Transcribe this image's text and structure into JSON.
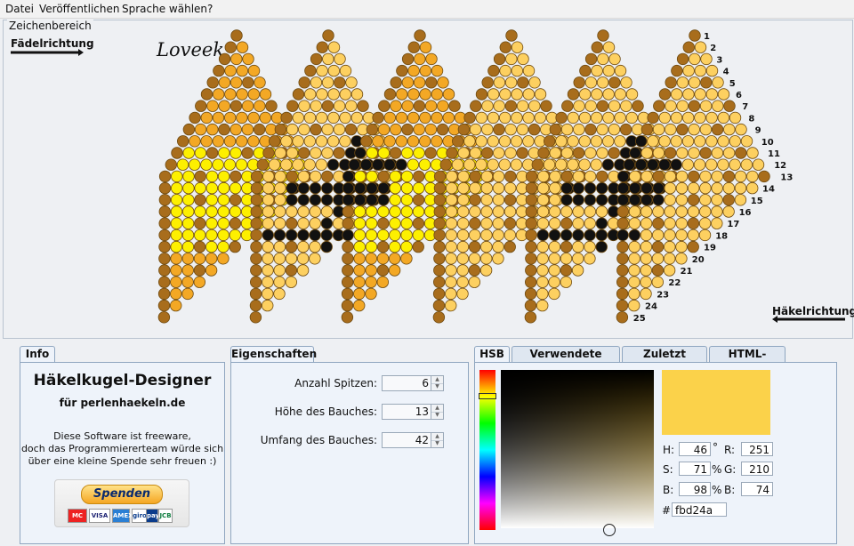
{
  "menu": [
    "Datei",
    "Veröffentlichen",
    "Sprache wählen",
    "?"
  ],
  "drawing": {
    "title": "Zeichenbereich",
    "thread_direction_label": "Fädelrichtung",
    "crochet_direction_label": "Häkelrichtung",
    "signature": "Loveek",
    "row_numbers": [
      "1",
      "2",
      "3",
      "4",
      "5",
      "6",
      "7",
      "8",
      "9",
      "10",
      "11",
      "12",
      "13",
      "14",
      "15",
      "16",
      "17",
      "18",
      "19",
      "20",
      "21",
      "22",
      "23",
      "24",
      "25"
    ],
    "palette": {
      "outline": "#6e4a10",
      "dark": "#a86d1c",
      "orange": "#f3a825",
      "light": "#fdd060",
      "yellow": "#fdf000",
      "black": "#111111"
    }
  },
  "tabs_left": {
    "info": "Info",
    "properties": "Eigenschaften"
  },
  "info": {
    "title": "Häkelkugel-Designer",
    "subtitle": "für perlenhaekeln.de",
    "text_lines": [
      "Diese Software ist freeware,",
      "doch das Programmiererteam würde sich",
      "über eine kleine Spende sehr freuen :)"
    ],
    "donate_label": "Spenden",
    "payment_icons": [
      "mastercard-icon",
      "visa-icon",
      "amex-icon",
      "giropay-icon",
      "paypal-icon",
      "jcb-icon"
    ],
    "payment_labels": [
      "MC",
      "VISA",
      "AMEX",
      "giro",
      "pay",
      "JCB"
    ]
  },
  "properties": {
    "fields": [
      {
        "label": "Anzahl Spitzen:",
        "value": "6"
      },
      {
        "label": "Höhe des Bauches:",
        "value": "13"
      },
      {
        "label": "Umfang des Bauches:",
        "value": "42"
      }
    ]
  },
  "color_tabs": [
    "HSB",
    "Verwendete Farben",
    "Zuletzt benutzt",
    "HTML-Farben"
  ],
  "color": {
    "swatch": "#fbd24a",
    "h_label": "H:",
    "h": "46",
    "h_unit": "°",
    "s_label": "S:",
    "s": "71",
    "s_unit": "%",
    "b_label": "B:",
    "b": "98",
    "b_unit": "%",
    "r_label": "R:",
    "r": "251",
    "g_label": "G:",
    "g": "210",
    "b2_label": "B:",
    "b2": "74",
    "hex_label": "#",
    "hex": "fbd24a"
  }
}
